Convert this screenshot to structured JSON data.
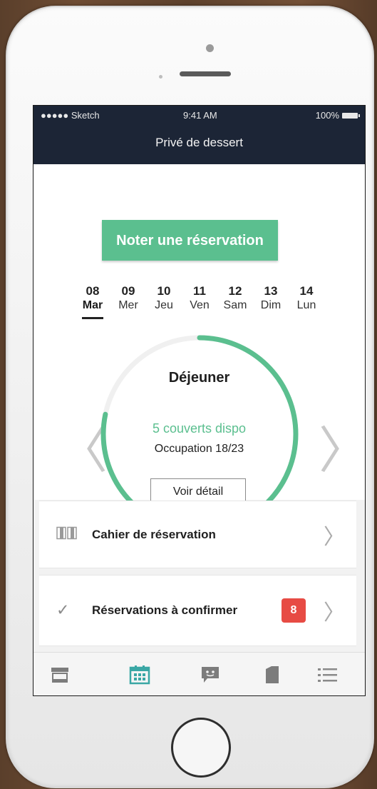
{
  "status_bar": {
    "carrier": "●●●●● Sketch",
    "time": "9:41 AM",
    "battery": "100%"
  },
  "nav": {
    "title": "Privé de dessert"
  },
  "primary_action": {
    "label": "Noter une réservation"
  },
  "days": [
    {
      "num": "08",
      "name": "Mar",
      "active": true
    },
    {
      "num": "09",
      "name": "Mer"
    },
    {
      "num": "10",
      "name": "Jeu"
    },
    {
      "num": "11",
      "name": "Ven"
    },
    {
      "num": "12",
      "name": "Sam"
    },
    {
      "num": "13",
      "name": "Dim"
    },
    {
      "num": "14",
      "name": "Lun"
    }
  ],
  "service": {
    "meal": "Déjeuner",
    "covers_available": "5 couverts dispo",
    "occupation": "Occupation 18/23",
    "occupied": 18,
    "capacity": 23,
    "detail_button": "Voir détail"
  },
  "menu": [
    {
      "label": "Cahier de réservation",
      "icon": "book-icon"
    },
    {
      "label": "Réservations à confirmer",
      "icon": "check-icon",
      "badge": "8"
    }
  ],
  "tabbar": [
    {
      "icon": "store-icon",
      "active": false
    },
    {
      "icon": "calendar-icon",
      "active": true
    },
    {
      "icon": "chat-icon",
      "active": false
    },
    {
      "icon": "document-icon",
      "active": false
    },
    {
      "icon": "list-icon",
      "active": false
    }
  ],
  "colors": {
    "accent": "#5bbf8f",
    "navbar": "#1c2536",
    "badge": "#e74b44"
  }
}
